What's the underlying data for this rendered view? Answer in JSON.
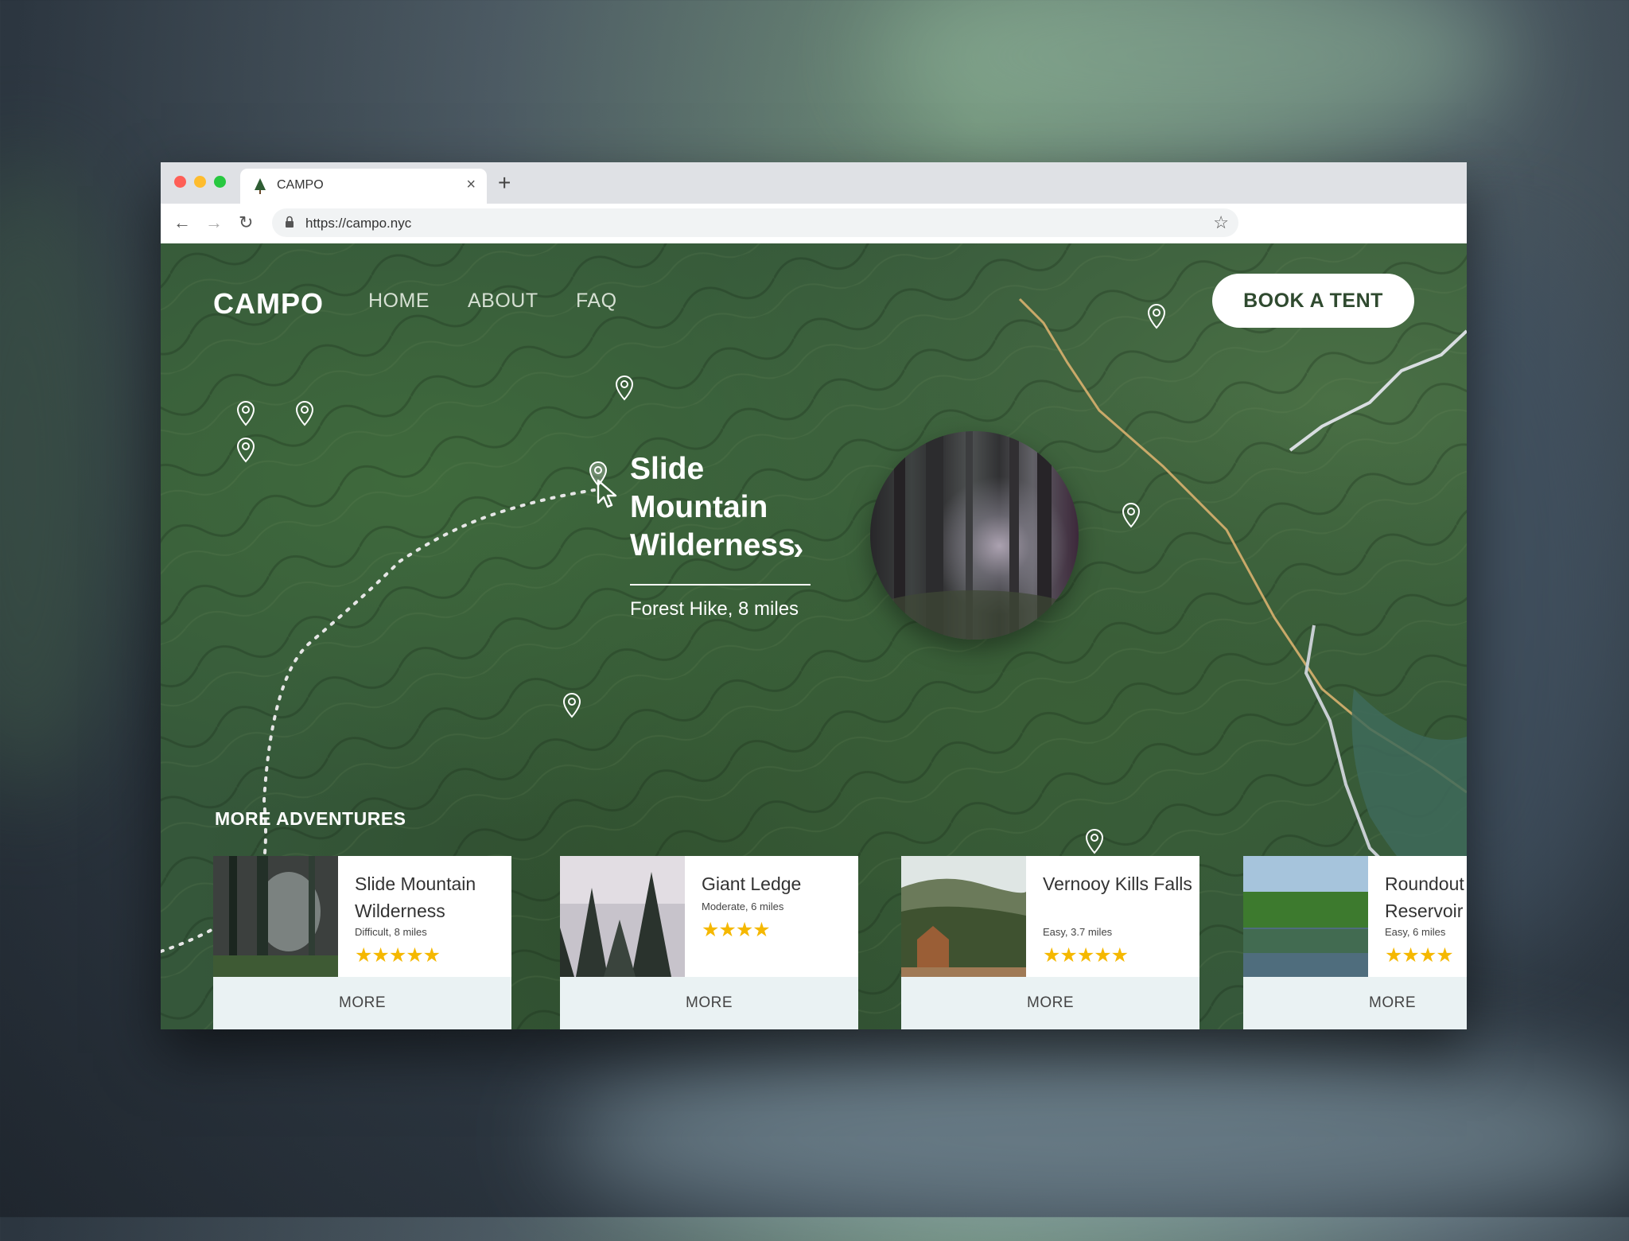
{
  "browser": {
    "tab_title": "CAMPO",
    "new_tab": "+",
    "close": "×",
    "url": "https://campo.nyc"
  },
  "site": {
    "logo": "CAMPO",
    "nav": [
      "HOME",
      "ABOUT",
      "FAQ"
    ],
    "cta": "BOOK A TENT"
  },
  "featured": {
    "title_lines": [
      "Slide",
      "Mountain",
      "Wilderness"
    ],
    "subtitle": "Forest Hike, 8 miles",
    "icon": "chevron-right-icon"
  },
  "more_adventures": {
    "heading": "MORE ADVENTURES",
    "cards": [
      {
        "title": "Slide Mountain Wilderness",
        "sub": "Difficult, 8 miles",
        "stars": "★★★★★",
        "rating": 5,
        "more": "MORE"
      },
      {
        "title": "Giant Ledge",
        "sub": "Moderate, 6 miles",
        "stars": "★★★★",
        "rating": 4,
        "more": "MORE"
      },
      {
        "title": "Vernooy Kills Falls",
        "sub": "Easy, 3.7 miles",
        "stars": "★★★★★",
        "rating": 5,
        "more": "MORE"
      },
      {
        "title": "Roundout Reservoir",
        "sub": "Easy, 6 miles",
        "stars": "★★★★",
        "rating": 4,
        "more": "MORE"
      }
    ]
  },
  "colors": {
    "map_green": "#35573a",
    "star_yellow": "#f5b800",
    "more_bg": "#eaf2f3",
    "cta_text": "#2f4a2f"
  }
}
